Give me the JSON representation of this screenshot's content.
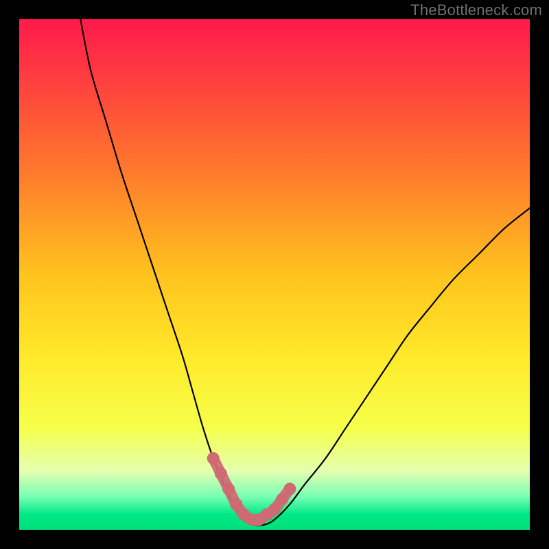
{
  "watermark": "TheBottleneck.com",
  "colors": {
    "frame": "#000000",
    "curve": "#000000",
    "highlight": "#cf6a72",
    "gradient_stops": [
      {
        "offset": 0.0,
        "color": "#ff1a4b"
      },
      {
        "offset": 0.12,
        "color": "#ff3f3f"
      },
      {
        "offset": 0.3,
        "color": "#ff7a2c"
      },
      {
        "offset": 0.5,
        "color": "#ffc31e"
      },
      {
        "offset": 0.66,
        "color": "#ffe92a"
      },
      {
        "offset": 0.8,
        "color": "#f6ff4a"
      },
      {
        "offset": 0.885,
        "color": "#e4ffb0"
      },
      {
        "offset": 0.935,
        "color": "#78ffb4"
      },
      {
        "offset": 0.97,
        "color": "#00e887"
      },
      {
        "offset": 1.0,
        "color": "#00e07a"
      }
    ]
  },
  "chart_data": {
    "type": "line",
    "title": "",
    "xlabel": "",
    "ylabel": "",
    "xlim": [
      0,
      100
    ],
    "ylim": [
      0,
      100
    ],
    "series": [
      {
        "name": "bottleneck-curve",
        "x": [
          12,
          14,
          17,
          20,
          23,
          26,
          29,
          32,
          34,
          36,
          38,
          40,
          42,
          44,
          46,
          48,
          50,
          53,
          56,
          60,
          64,
          68,
          72,
          76,
          80,
          85,
          90,
          95,
          100
        ],
        "y": [
          100,
          90,
          80,
          70,
          61,
          52,
          43,
          34,
          27,
          20,
          14,
          9,
          5,
          2,
          1,
          1,
          2,
          5,
          9,
          14,
          20,
          26,
          32,
          38,
          43,
          49,
          54,
          59,
          63
        ]
      }
    ],
    "highlight": {
      "name": "optimal-range",
      "x": [
        38,
        39.5,
        41,
        42.5,
        44,
        45.5,
        47,
        48.5,
        50,
        51.5,
        53
      ],
      "y": [
        14,
        11,
        8,
        5,
        3,
        2,
        2,
        3,
        4,
        6,
        8
      ]
    },
    "note": "x/y are in percent of the plot area (0=left/bottom, 100=right/top). Background is a vertical severity gradient (red→yellow→green)."
  }
}
